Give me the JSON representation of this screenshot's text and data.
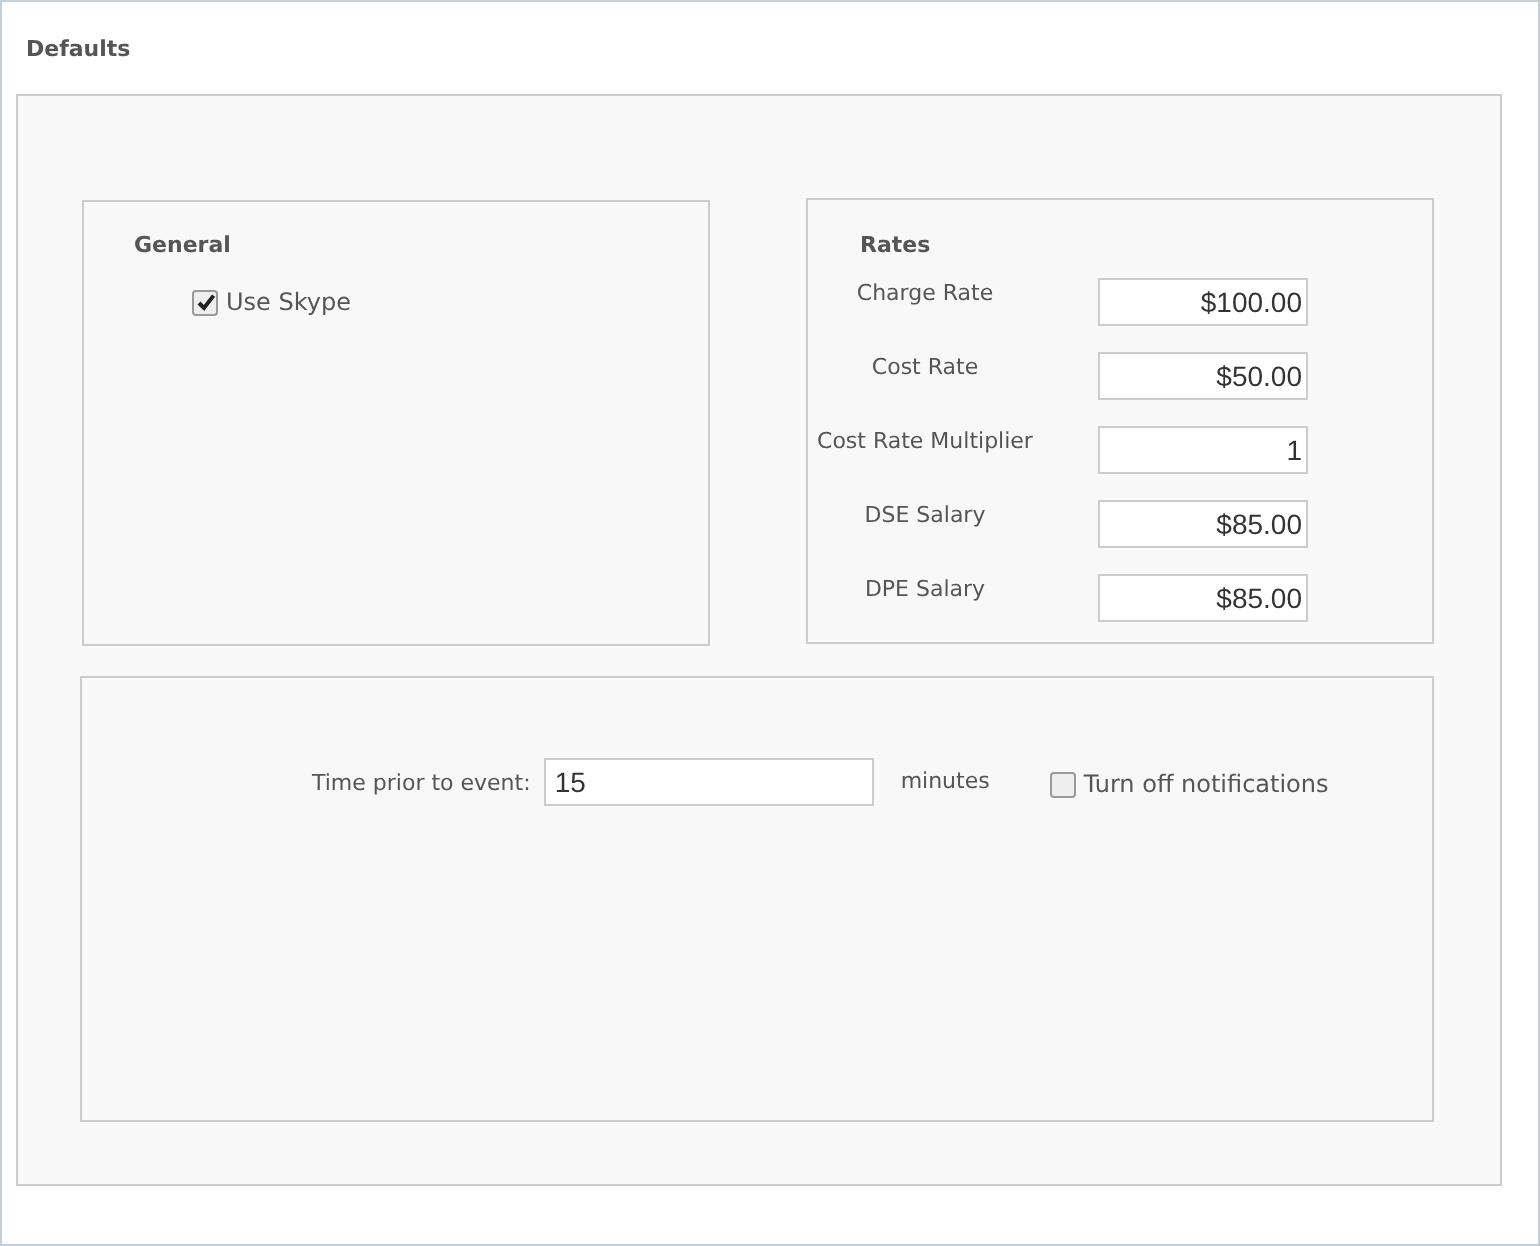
{
  "title": "Defaults",
  "general": {
    "heading": "General",
    "options": [
      {
        "label": "Use Skype",
        "checked": true
      }
    ]
  },
  "rates": {
    "heading": "Rates",
    "fields": [
      {
        "label": "Charge Rate",
        "value": "$100.00"
      },
      {
        "label": "Cost Rate",
        "value": "$50.00"
      },
      {
        "label": "Cost Rate Multiplier",
        "value": "1"
      },
      {
        "label": "DSE Salary",
        "value": "$85.00"
      },
      {
        "label": "DPE Salary",
        "value": "$85.00"
      }
    ]
  },
  "notifications": {
    "label": "Time prior to event:",
    "value": "15",
    "unit": "minutes",
    "toggle": {
      "label": "Turn off notifications",
      "checked": false
    }
  }
}
